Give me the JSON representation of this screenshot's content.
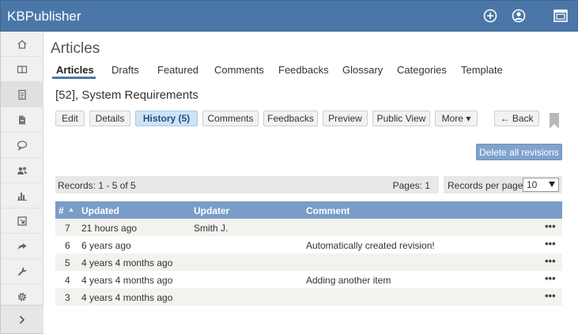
{
  "app": {
    "title": "KBPublisher"
  },
  "header_icons": [
    "add-circle-icon",
    "user-circle-icon",
    "window-icon"
  ],
  "sidebar": {
    "items": [
      {
        "icon": "home-icon"
      },
      {
        "icon": "book-icon"
      },
      {
        "icon": "article-icon"
      },
      {
        "icon": "file-icon"
      },
      {
        "icon": "comments-icon"
      },
      {
        "icon": "users-icon"
      },
      {
        "icon": "bar-chart-icon"
      },
      {
        "icon": "import-icon"
      },
      {
        "icon": "share-icon"
      },
      {
        "icon": "wrench-icon"
      },
      {
        "icon": "gear-icon"
      }
    ],
    "expand_icon": "chevron-right-icon"
  },
  "page": {
    "title": "Articles"
  },
  "tabs": [
    {
      "label": "Articles"
    },
    {
      "label": "Drafts"
    },
    {
      "label": "Featured"
    },
    {
      "label": "Comments"
    },
    {
      "label": "Feedbacks"
    },
    {
      "label": "Glossary"
    },
    {
      "label": "Categories"
    },
    {
      "label": "Template"
    }
  ],
  "article": {
    "heading": "[52], System Requirements"
  },
  "actions": [
    {
      "label": "Edit"
    },
    {
      "label": "Details"
    },
    {
      "label": "History (5)"
    },
    {
      "label": "Comments"
    },
    {
      "label": "Feedbacks"
    },
    {
      "label": "Preview"
    },
    {
      "label": "Public View"
    },
    {
      "label": "More ▾"
    },
    {
      "label": "← Back"
    }
  ],
  "delete_all_label": "Delete all revisions",
  "records": {
    "summary": "Records: 1 - 5 of 5",
    "pages": "Pages: 1",
    "per_page_label": "Records per page:",
    "per_page_value": "10"
  },
  "table": {
    "columns": [
      "#",
      "Updated",
      "Updater",
      "Comment"
    ],
    "rows": [
      {
        "num": "7",
        "updated": "21 hours ago",
        "updater": "Smith J.",
        "comment": ""
      },
      {
        "num": "6",
        "updated": "6 years ago",
        "updater": "",
        "comment": "Automatically created revision!"
      },
      {
        "num": "5",
        "updated": "4 years 4 months ago",
        "updater": "",
        "comment": ""
      },
      {
        "num": "4",
        "updated": "4 years 4 months ago",
        "updater": "",
        "comment": "Adding another item"
      },
      {
        "num": "3",
        "updated": "4 years 4 months ago",
        "updater": "",
        "comment": ""
      }
    ],
    "row_menu": "•••"
  },
  "colors": {
    "header_bg": "#4a77a8",
    "table_header_bg": "#7a9cc6",
    "active_button_bg": "#cde3f7",
    "delete_button_bg": "#7fa3cc"
  }
}
